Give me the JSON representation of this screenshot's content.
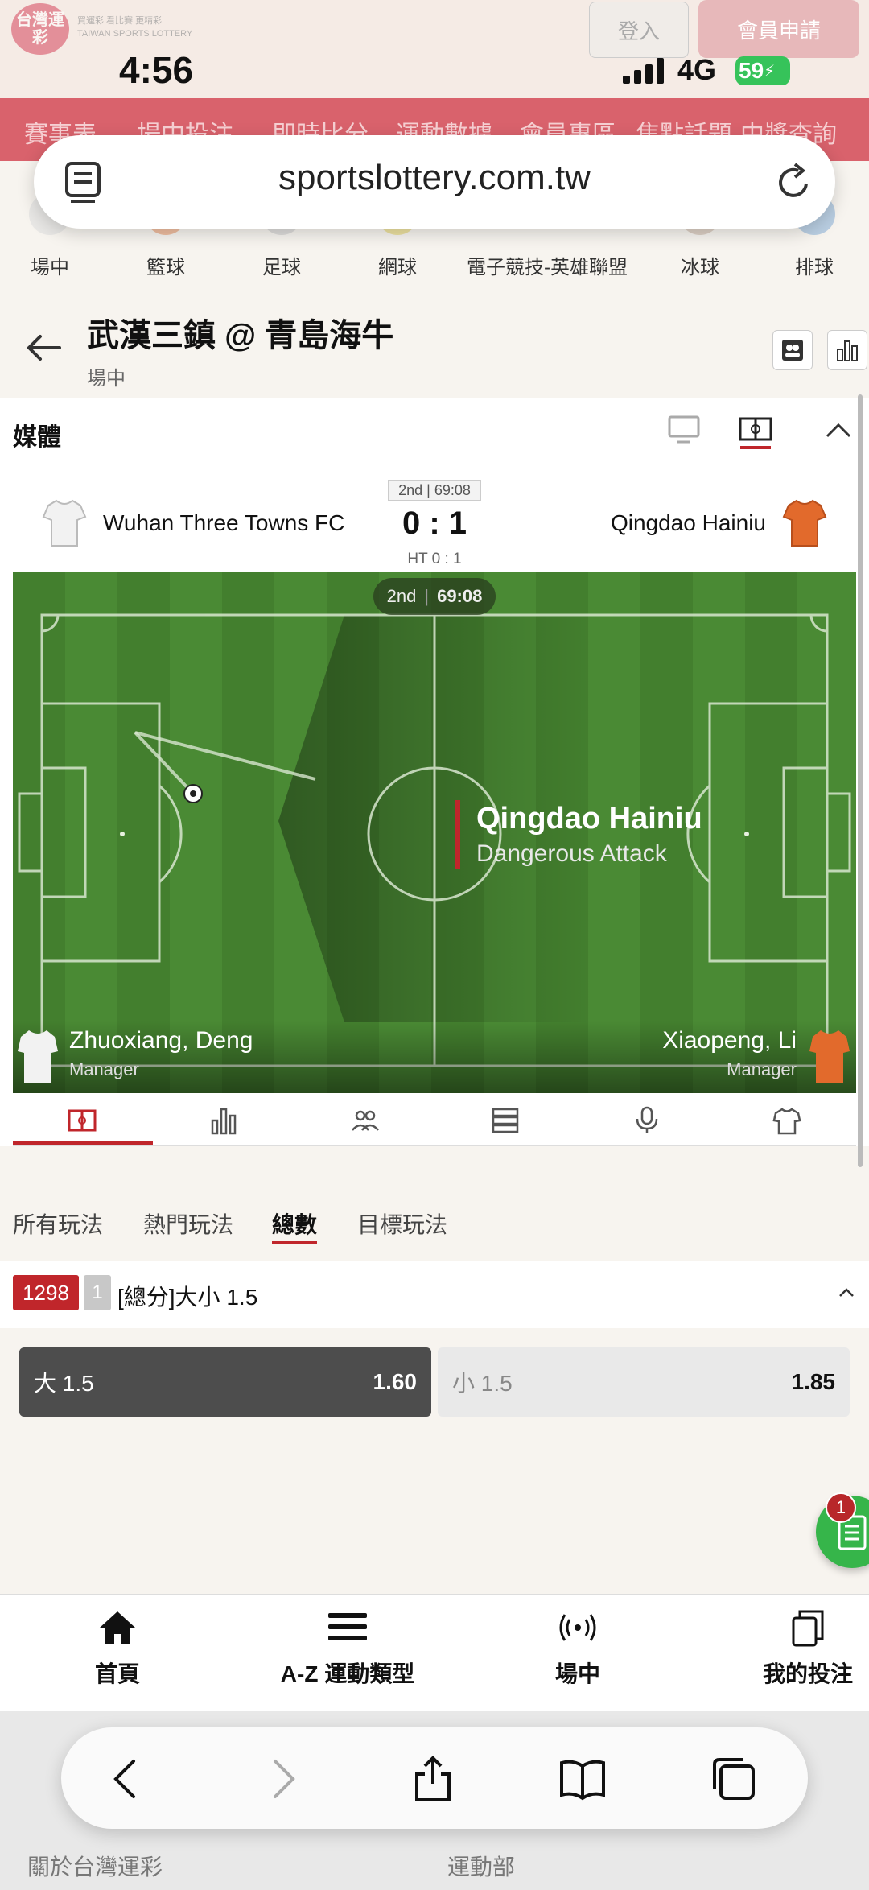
{
  "site": {
    "logo_text": "台灣運彩",
    "logo_sub_line1": "買運彩 看比賽 更精彩",
    "logo_sub_line2": "TAIWAN SPORTS LOTTERY",
    "login": "登入",
    "member_apply": "會員申請"
  },
  "status_bar": {
    "time": "4:56",
    "network": "4G",
    "battery": "59"
  },
  "top_nav": [
    "賽事表",
    "場中投注",
    "即時比分",
    "運動數據",
    "會員專區",
    "焦點話題",
    "中獎查詢"
  ],
  "browser": {
    "url": "sportslottery.com.tw"
  },
  "sports": [
    "場中",
    "籃球",
    "足球",
    "網球",
    "電子競技-英雄聯盟",
    "冰球",
    "排球"
  ],
  "match": {
    "title": "武漢三鎮 @ 青島海牛",
    "subtitle": "場中",
    "media_label": "媒體",
    "period_chip": "2nd | 69:08",
    "home_team": "Wuhan Three Towns FC",
    "away_team": "Qingdao Hainiu",
    "score": "0 : 1",
    "halftime": "HT 0 : 1",
    "pitch_chip_period": "2nd",
    "pitch_chip_time": "69:08",
    "event_team": "Qingdao Hainiu",
    "event_text": "Dangerous Attack",
    "home_manager": "Zhuoxiang, Deng",
    "away_manager": "Xiaopeng, Li",
    "manager_role": "Manager"
  },
  "market_tabs": [
    "所有玩法",
    "熱門玩法",
    "總數",
    "目標玩法"
  ],
  "market": {
    "id": "1298",
    "num": "1",
    "title": "[總分]大小 1.5",
    "over_label": "大 1.5",
    "over_odds": "1.60",
    "under_label": "小 1.5",
    "under_odds": "1.85"
  },
  "fab_badge": "1",
  "bottom_nav": [
    "首頁",
    "A-Z 運動類型",
    "場中",
    "我的投注"
  ],
  "footer": {
    "about": "關於台灣運彩",
    "ministry": "運動部"
  },
  "colors": {
    "accent": "#c0262b",
    "fab": "#36b54a",
    "pitch": "#3f7a2a"
  }
}
